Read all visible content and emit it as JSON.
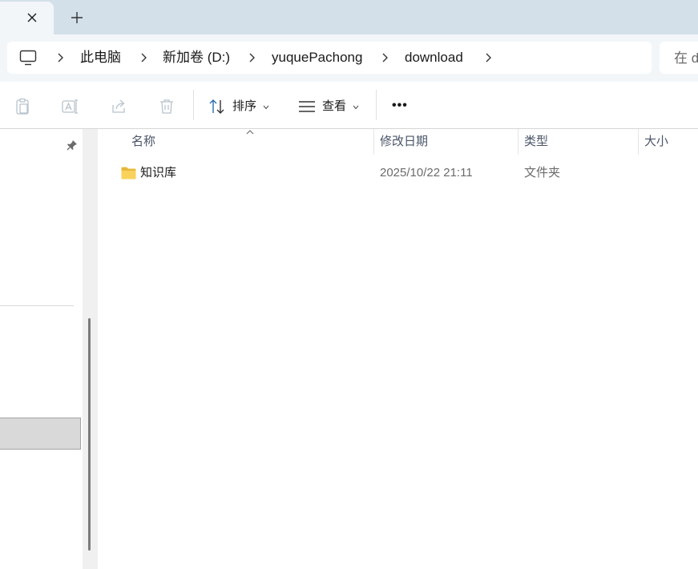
{
  "tabs": {
    "close_symbol": "✕",
    "new_tab_symbol": "+"
  },
  "address": {
    "breadcrumbs": [
      "此电脑",
      "新加卷 (D:)",
      "yuquePachong",
      "download"
    ],
    "search_placeholder": "在 d"
  },
  "toolbar": {
    "sort_label": "排序",
    "view_label": "查看",
    "more_label": "•••"
  },
  "columns": {
    "name": "名称",
    "modified": "修改日期",
    "type": "类型",
    "size": "大小"
  },
  "files": [
    {
      "name": "知识库",
      "modified": "2025/10/22 21:11",
      "type": "文件夹",
      "size": ""
    }
  ],
  "colors": {
    "tabbar_bg": "#d3e0ea",
    "chrome_bg": "#f3f6f9",
    "accent": "#2b6cb0",
    "folder": "#f4c542"
  }
}
